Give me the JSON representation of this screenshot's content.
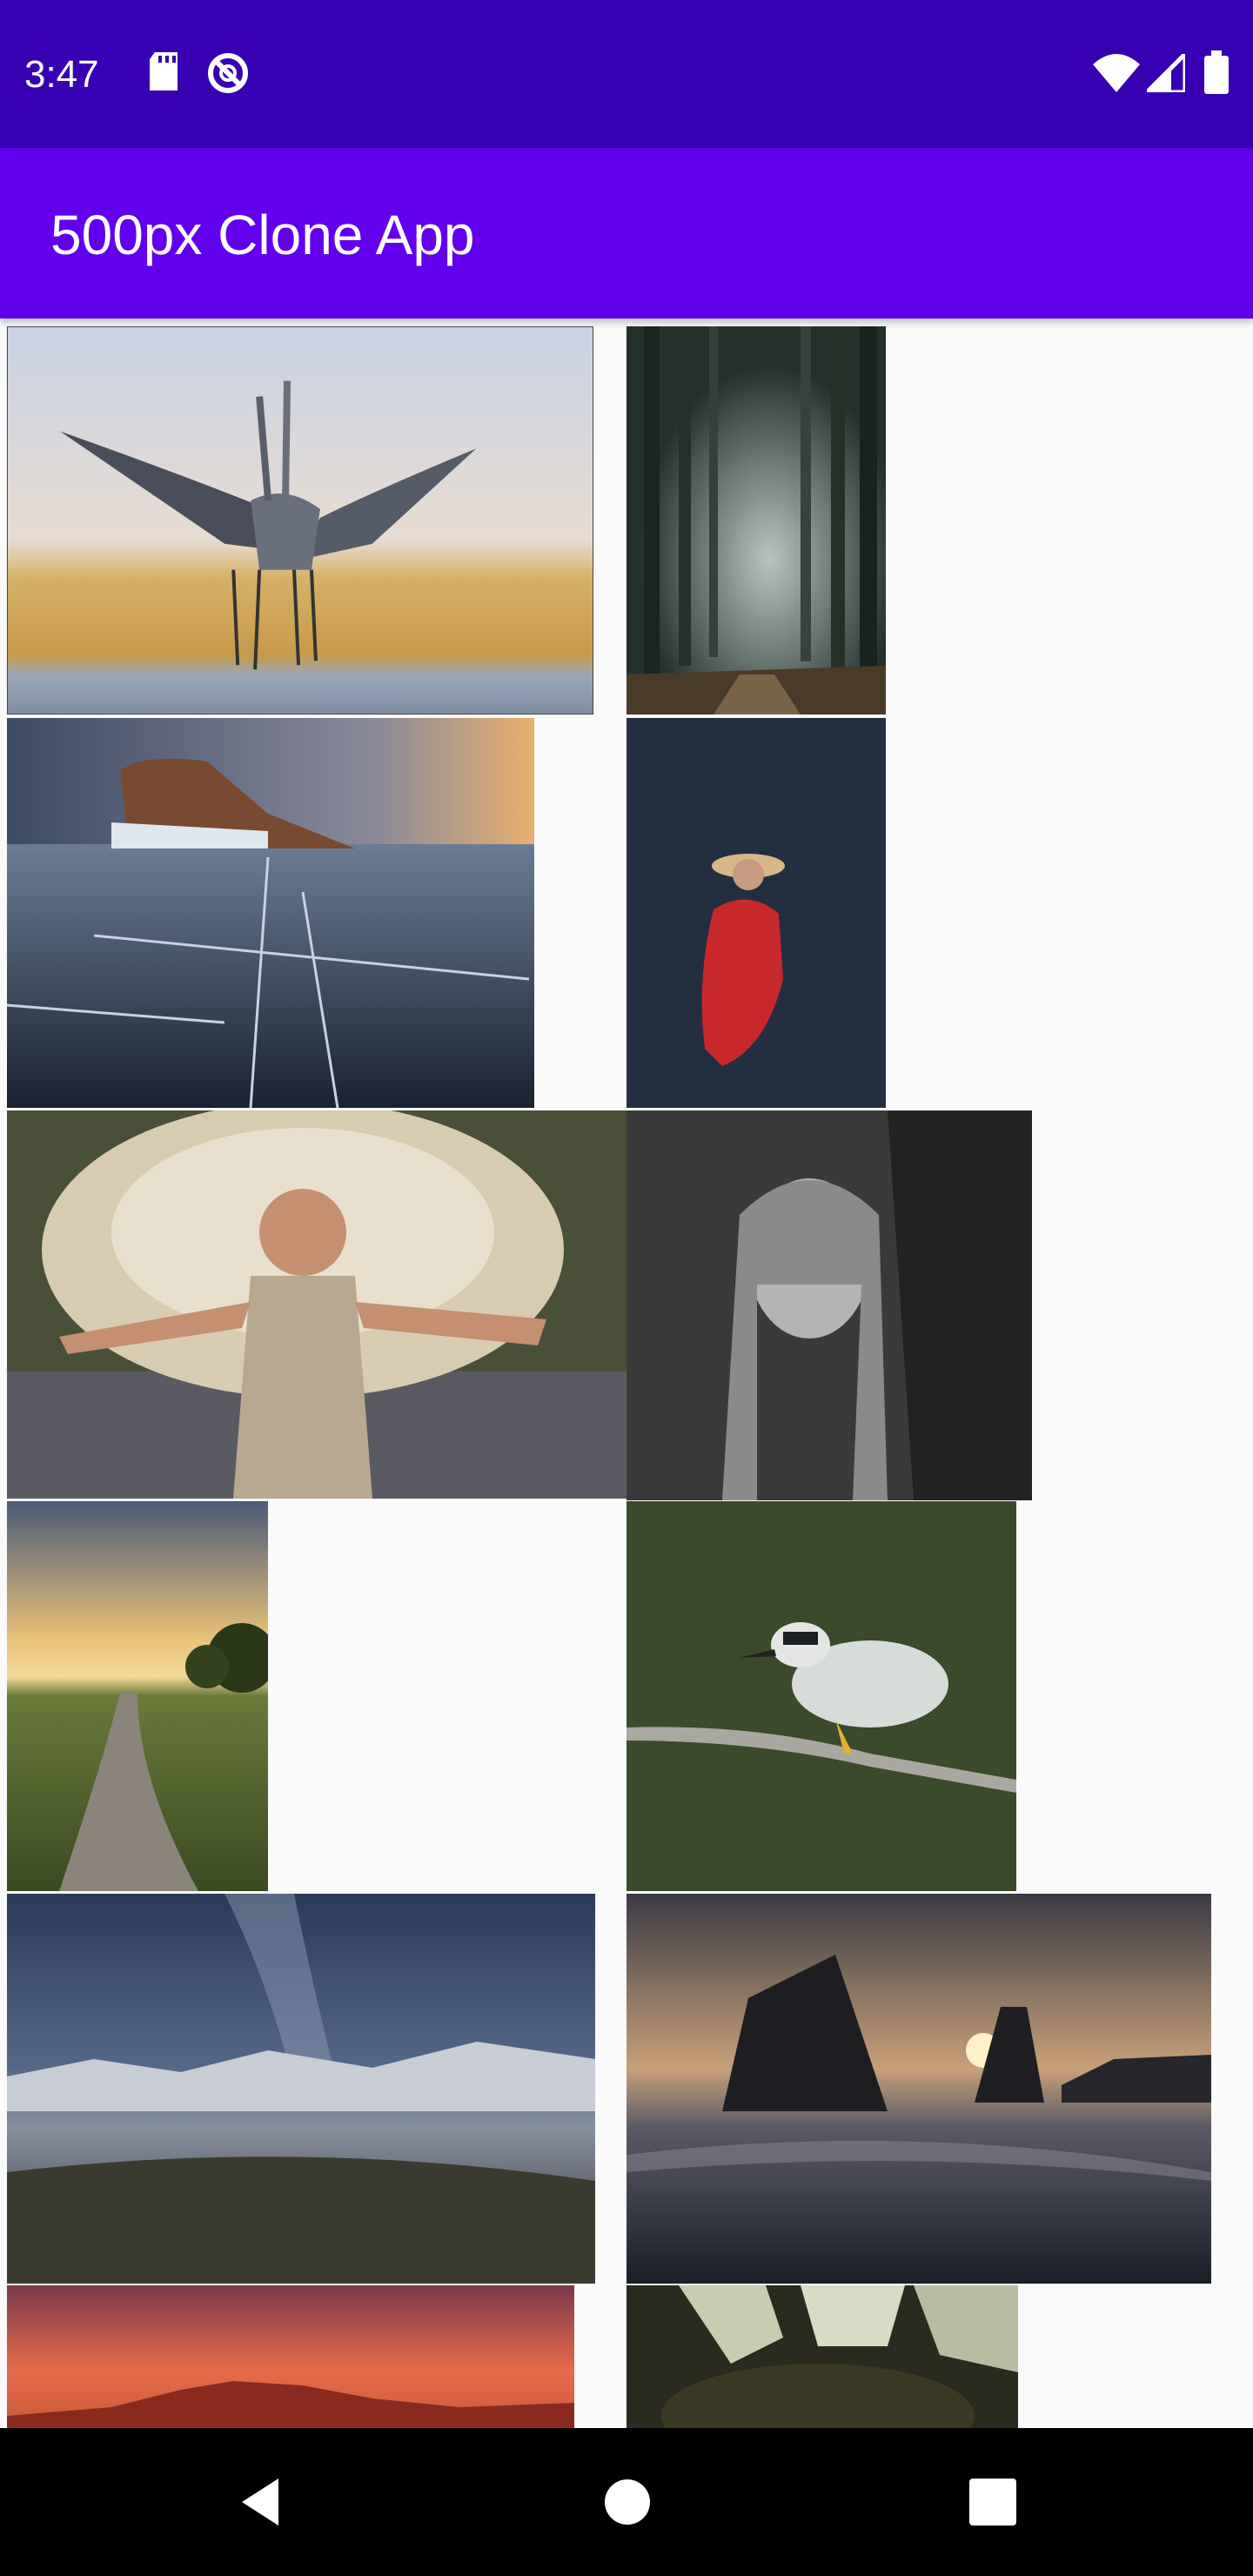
{
  "status_bar": {
    "time": "3:47",
    "icons_left": [
      "sd-card-icon",
      "do-not-disturb-icon"
    ],
    "icons_right": [
      "wifi-icon",
      "cellular-signal-icon",
      "battery-icon"
    ]
  },
  "app_bar": {
    "title": "500px Clone App"
  },
  "photos": [
    {
      "subject": "two cranes dancing over reeds"
    },
    {
      "subject": "misty pine forest path"
    },
    {
      "subject": "frozen lake with rock island at sunset"
    },
    {
      "subject": "woman in red dress in lavender field"
    },
    {
      "subject": "carnival dancer with feather headdress"
    },
    {
      "subject": "black and white portrait of woman with leaves"
    },
    {
      "subject": "country road at sunset"
    },
    {
      "subject": "night heron on branch"
    },
    {
      "subject": "milky way over mountains"
    },
    {
      "subject": "sea stacks at sunset"
    },
    {
      "subject": "red sky over mountains"
    },
    {
      "subject": "sunflower close-up"
    }
  ],
  "nav_bar": {
    "buttons": [
      "back",
      "home",
      "recents"
    ]
  },
  "colors": {
    "status_bar": "#3700b3",
    "app_bar": "#6200ee",
    "background": "#fafafa",
    "nav_bar": "#000000"
  }
}
